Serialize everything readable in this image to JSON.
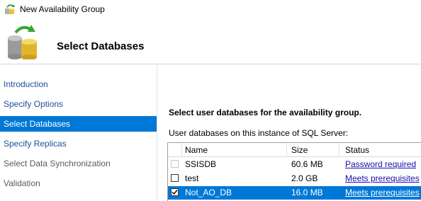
{
  "window": {
    "title": "New Availability Group"
  },
  "header": {
    "title": "Select Databases"
  },
  "sidebar": {
    "items": [
      {
        "label": "Introduction",
        "state": "link"
      },
      {
        "label": "Specify Options",
        "state": "link"
      },
      {
        "label": "Select Databases",
        "state": "selected"
      },
      {
        "label": "Specify Replicas",
        "state": "link"
      },
      {
        "label": "Select Data Synchronization",
        "state": "plain"
      },
      {
        "label": "Validation",
        "state": "plain"
      }
    ]
  },
  "main": {
    "instruction": "Select user databases for the availability group.",
    "subtitle": "User databases on this instance of SQL Server:",
    "table": {
      "columns": [
        "Name",
        "Size",
        "Status"
      ],
      "rows": [
        {
          "checked": false,
          "disabled": true,
          "name": "SSISDB",
          "size": "60.6 MB",
          "status": "Password required",
          "selected": false
        },
        {
          "checked": false,
          "disabled": false,
          "name": "test",
          "size": "2.0 GB",
          "status": "Meets prerequisites",
          "selected": false
        },
        {
          "checked": true,
          "disabled": false,
          "name": "Not_AO_DB",
          "size": "16.0 MB",
          "status": "Meets prerequisites",
          "selected": true
        }
      ]
    }
  },
  "colors": {
    "accent": "#0078d7",
    "link": "#1f4e9f"
  },
  "icons": {
    "app": "database-sync-icon",
    "header": "database-sync-icon"
  }
}
